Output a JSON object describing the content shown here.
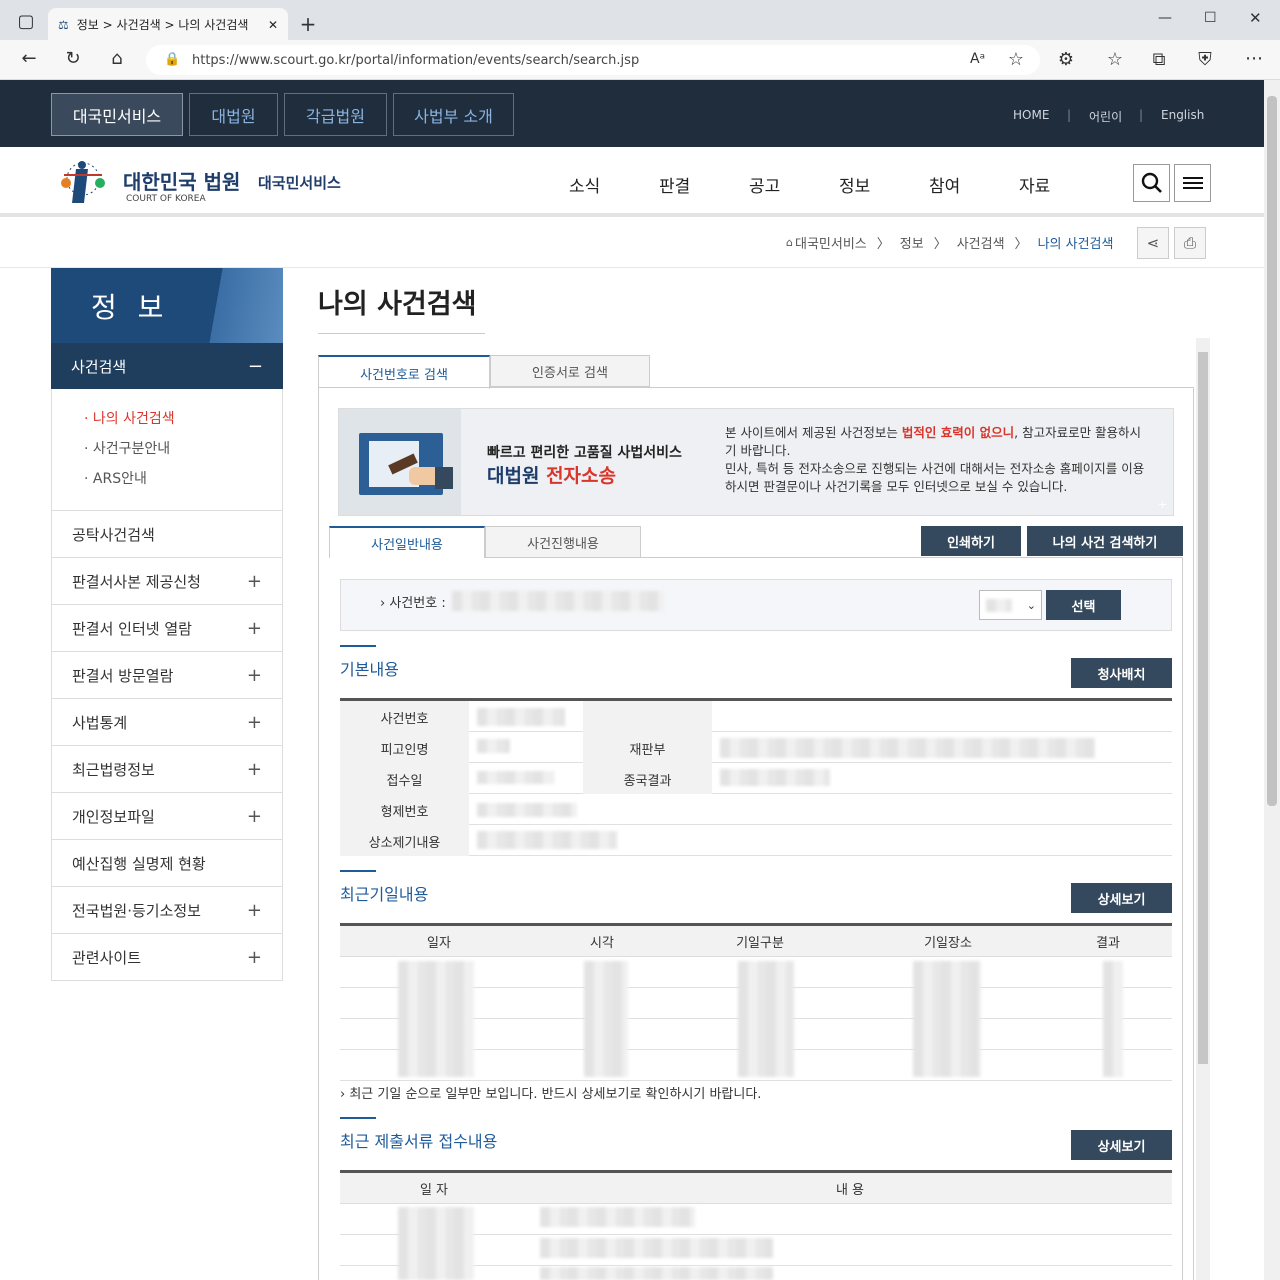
{
  "browser": {
    "tab_title": "정보 > 사건검색 > 나의 사건검색",
    "url": "https://www.scourt.go.kr/portal/information/events/search/search.jsp"
  },
  "topbar": {
    "tabs": [
      "대국민서비스",
      "대법원",
      "각급법원",
      "사법부 소개"
    ],
    "links": [
      "HOME",
      "어린이",
      "English"
    ]
  },
  "header": {
    "logo_title": "대한민국 법원",
    "logo_sub": "COURT OF KOREA",
    "service": "대국민서비스",
    "nav": [
      "소식",
      "판결",
      "공고",
      "정보",
      "참여",
      "자료"
    ]
  },
  "breadcrumb": [
    "대국민서비스",
    "정보",
    "사건검색",
    "나의 사건검색"
  ],
  "sidebar": {
    "title": "정 보",
    "active": "사건검색",
    "sub_items": [
      "나의 사건검색",
      "사건구분안내",
      "ARS안내"
    ],
    "items": [
      {
        "label": "공탁사건검색",
        "expand": ""
      },
      {
        "label": "판결서사본 제공신청",
        "expand": "+"
      },
      {
        "label": "판결서 인터넷 열람",
        "expand": "+"
      },
      {
        "label": "판결서 방문열람",
        "expand": "+"
      },
      {
        "label": "사법통계",
        "expand": "+"
      },
      {
        "label": "최근법령정보",
        "expand": "+"
      },
      {
        "label": "개인정보파일",
        "expand": "+"
      },
      {
        "label": "예산집행 실명제 현황",
        "expand": ""
      },
      {
        "label": "전국법원·등기소정보",
        "expand": "+"
      },
      {
        "label": "관련사이트",
        "expand": "+"
      }
    ]
  },
  "main": {
    "title": "나의 사건검색",
    "tabs": [
      "사건번호로 검색",
      "인증서로 검색"
    ],
    "banner": {
      "line1": "빠르고 편리한 고품질 사법서비스",
      "line2a": "대법원 ",
      "line2b": "전자소송",
      "notice1a": "본 사이트에서 제공된 사건정보는 ",
      "notice1b": "법적인 효력이 없으니",
      "notice1c": ", 참고자료로만 활용하시기 바랍니다.",
      "notice2": "민사, 특허 등 전자소송으로 진행되는 사건에 대해서는 전자소송 홈페이지를 이용하시면 판결문이나 사건기록을 모두 인터넷으로 보실 수 있습니다."
    },
    "subtabs": [
      "사건일반내용",
      "사건진행내용"
    ],
    "print_btn": "인쇄하기",
    "search_btn": "나의 사건 검색하기",
    "case_label": "사건번호 :",
    "select_btn": "선택",
    "basic": {
      "title": "기본내용",
      "btn": "청사배치",
      "labels": [
        "사건번호",
        "피고인명",
        "재판부",
        "접수일",
        "종국결과",
        "형제번호",
        "상소제기내용"
      ]
    },
    "hearings": {
      "title": "최근기일내용",
      "btn": "상세보기",
      "cols": [
        "일자",
        "시각",
        "기일구분",
        "기일장소",
        "결과"
      ],
      "note": "최근 기일 순으로 일부만 보입니다. 반드시 상세보기로 확인하시기 바랍니다."
    },
    "docs": {
      "title": "최근 제출서류 접수내용",
      "btn": "상세보기",
      "cols": [
        "일 자",
        "내 용"
      ]
    }
  }
}
